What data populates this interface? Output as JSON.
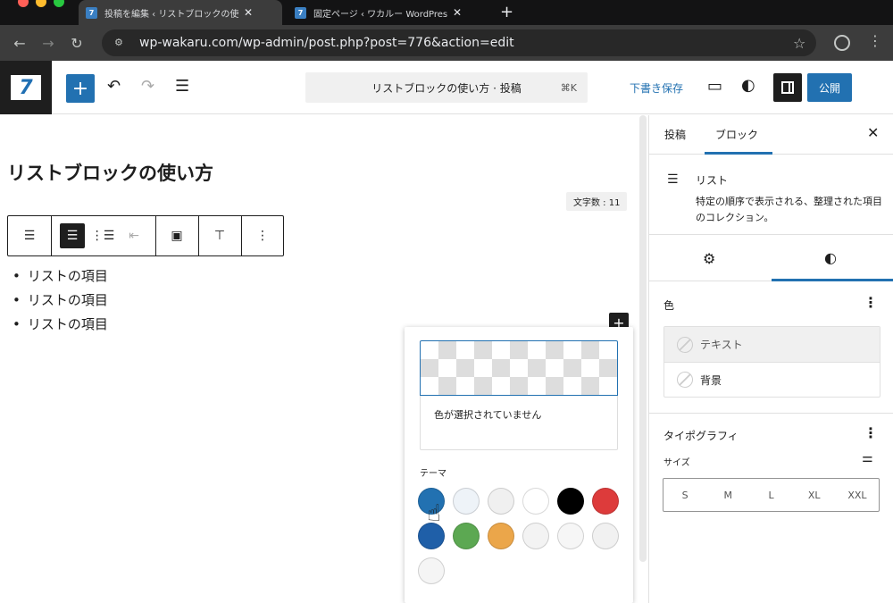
{
  "browser": {
    "tabs": [
      {
        "title": "投稿を編集 ‹ リストブロックの使",
        "active": true
      },
      {
        "title": "固定ページ ‹ ワカルー WordPress",
        "active": false
      }
    ],
    "url": "wp-wakaru.com/wp-admin/post.php?post=776&action=edit"
  },
  "wp": {
    "logo": "7",
    "command_bar": "リストブロックの使い方 · 投稿",
    "command_shortcut": "⌘K",
    "save_draft": "下書き保存",
    "publish": "公開"
  },
  "editor": {
    "title": "リストブロックの使い方",
    "word_count": "文字数 : 11",
    "list_items": [
      "リストの項目",
      "リストの項目",
      "リストの項目"
    ]
  },
  "popover": {
    "no_color": "色が選択されていません",
    "theme_label": "テーマ",
    "swatches": [
      "#2271b1",
      "#eef3f8",
      "#f0f0f0",
      "#ffffff",
      "#000000",
      "#dd3b3b",
      "#1f5fa8",
      "#5ca852",
      "#eba64a",
      "#f3f3f3",
      "#f6f6f6",
      "#f1f1f1",
      "#f5f5f5"
    ]
  },
  "sidebar": {
    "tab_post": "投稿",
    "tab_block": "ブロック",
    "block_name": "リスト",
    "block_desc": "特定の順序で表示される、整理された項目のコレクション。",
    "color_title": "色",
    "color_text": "テキスト",
    "color_bg": "背景",
    "typo_title": "タイポグラフィ",
    "size_label": "サイズ",
    "sizes": [
      "S",
      "M",
      "L",
      "XL",
      "XXL"
    ]
  }
}
